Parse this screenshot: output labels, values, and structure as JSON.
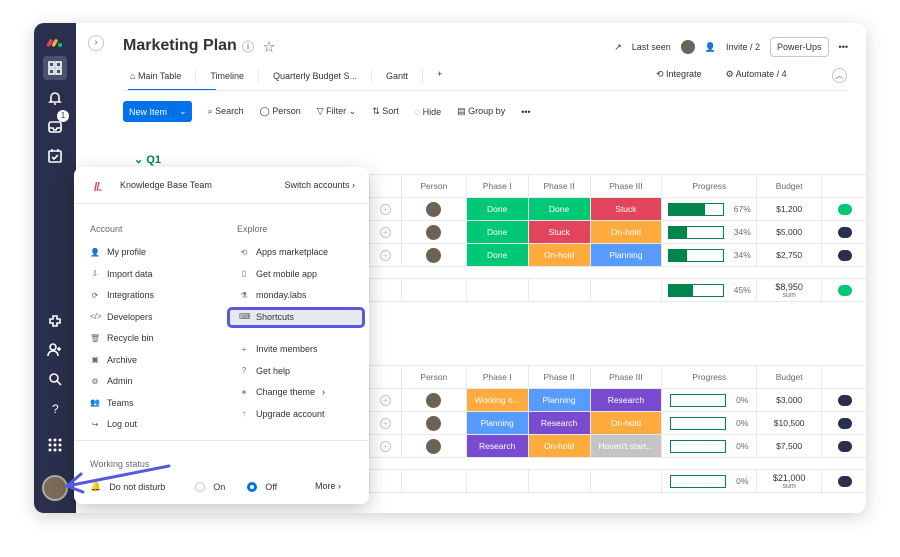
{
  "board": {
    "title": "Marketing Plan",
    "last_seen": "Last seen",
    "invite": "Invite / 2",
    "powerups": "Power-Ups",
    "more": "•••"
  },
  "tabs": [
    "Main Table",
    "Timeline",
    "Quarterly Budget S...",
    "Gantt",
    "+"
  ],
  "tabs_right": {
    "integrate": "Integrate",
    "automate": "Automate / 4"
  },
  "toolbar": {
    "new_item": "New Item",
    "search": "Search",
    "person": "Person",
    "filter": "Filter",
    "sort": "Sort",
    "hide": "Hide",
    "group_by": "Group by",
    "more": "•••"
  },
  "group": {
    "name": "Q1"
  },
  "columns": [
    "Person",
    "Phase I",
    "Phase II",
    "Phase III",
    "Progress",
    "Budget"
  ],
  "rows1": [
    {
      "p1": "Done",
      "c1": "#00c875",
      "p2": "Done",
      "c2": "#00c875",
      "p3": "Stuck",
      "c3": "#e2445c",
      "prog": 67,
      "pct": "67%",
      "budget": "$1,200",
      "tail": ""
    },
    {
      "p1": "Done",
      "c1": "#00c875",
      "p2": "Stuck",
      "c2": "#e2445c",
      "p3": "On-hold",
      "c3": "#fdab3d",
      "prog": 34,
      "pct": "34%",
      "budget": "$5,000",
      "tail": "M"
    },
    {
      "p1": "Done",
      "c1": "#00c875",
      "p2": "On-hold",
      "c2": "#fdab3d",
      "p3": "Planning",
      "c3": "#579bfc",
      "prog": 34,
      "pct": "34%",
      "budget": "$2,750",
      "tail": "S"
    }
  ],
  "sum1": {
    "prog": 45,
    "pct": "45%",
    "budget": "$8,950",
    "sub": "sum",
    "tail": "J"
  },
  "rows2": [
    {
      "p1": "Working o...",
      "c1": "#fdab3d",
      "p2": "Planning",
      "c2": "#579bfc",
      "p3": "Research",
      "c3": "#784bd1",
      "prog": 0,
      "pct": "0%",
      "budget": "$3,000",
      "tail": "S"
    },
    {
      "p1": "Planning",
      "c1": "#579bfc",
      "p2": "Research",
      "c2": "#784bd1",
      "p3": "On-hold",
      "c3": "#fdab3d",
      "prog": 0,
      "pct": "0%",
      "budget": "$10,500",
      "tail": "O"
    },
    {
      "p1": "Research",
      "c1": "#784bd1",
      "p2": "On-hold",
      "c2": "#fdab3d",
      "p3": "Haven't start...",
      "c3": "#c4c4c4",
      "prog": 0,
      "pct": "0%",
      "budget": "$7,500",
      "tail": "O"
    }
  ],
  "sum2": {
    "prog": 0,
    "pct": "0%",
    "budget": "$21,000",
    "sub": "sum",
    "tail": "S"
  },
  "menu": {
    "team": "Knowledge Base Team",
    "switch": "Switch accounts",
    "account_title": "Account",
    "explore_title": "Explore",
    "account": [
      "My profile",
      "Import data",
      "Integrations",
      "Developers",
      "Recycle bin",
      "Archive",
      "Admin",
      "Teams",
      "Log out"
    ],
    "explore": [
      "Apps marketplace",
      "Get mobile app",
      "monday.labs",
      "Shortcuts"
    ],
    "explore2": [
      "Invite members",
      "Get help",
      "Change theme",
      "Upgrade account"
    ],
    "working_status": "Working status",
    "dnd": "Do not disturb",
    "on": "On",
    "off": "Off",
    "more": "More"
  },
  "rail": {
    "badge": "1"
  }
}
